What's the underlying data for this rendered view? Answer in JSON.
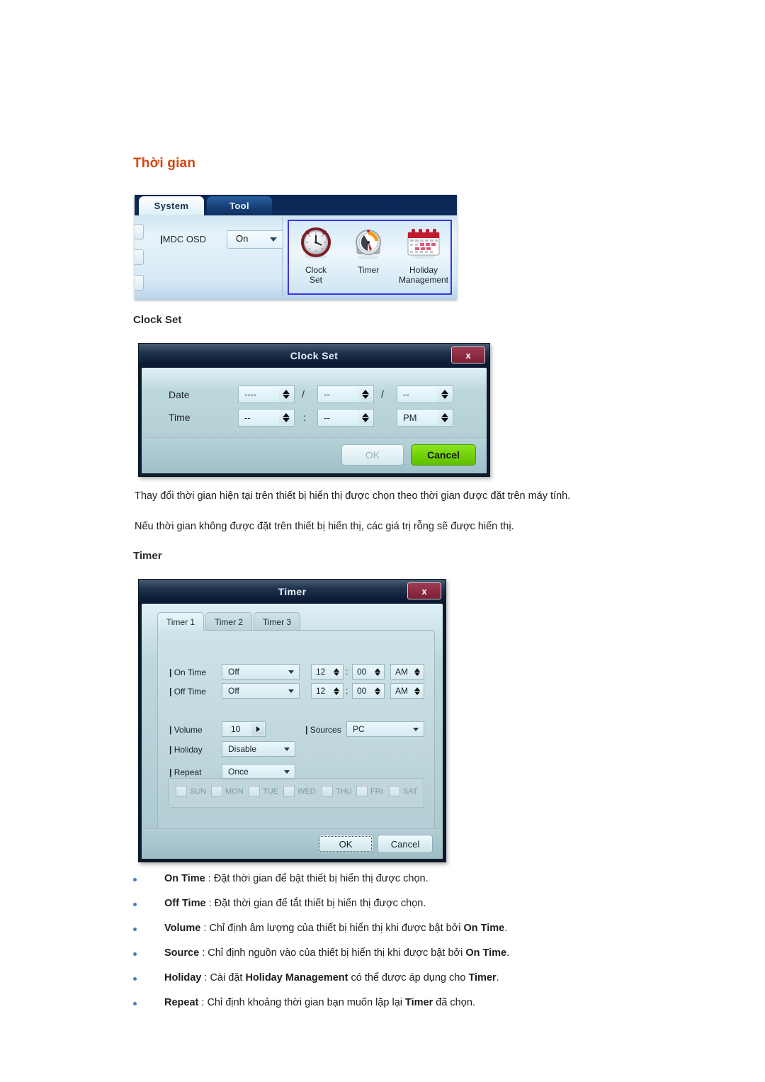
{
  "page": {
    "heading": "Thời gian"
  },
  "ribbon": {
    "tabs": [
      {
        "label": "System",
        "active": true
      },
      {
        "label": "Tool",
        "active": false
      }
    ],
    "setting": {
      "label": "MDC OSD",
      "value": "On"
    },
    "icons": [
      {
        "name": "clock-set",
        "line1": "Clock",
        "line2": "Set"
      },
      {
        "name": "timer",
        "line1": "Timer",
        "line2": ""
      },
      {
        "name": "holiday-management",
        "line1": "Holiday",
        "line2": "Management"
      }
    ],
    "accent_color": "#3a34e8"
  },
  "clock_set": {
    "heading": "Clock Set",
    "dialog_title": "Clock Set",
    "close_label": "x",
    "date_label": "Date",
    "time_label": "Time",
    "date": {
      "year": "----",
      "month": "--",
      "day": "--",
      "separator": "/"
    },
    "time": {
      "hour": "--",
      "minute": "--",
      "meridiem": "PM",
      "separator": ":"
    },
    "buttons": {
      "ok": "OK",
      "cancel": "Cancel",
      "cancel_color": "#78d512"
    }
  },
  "paragraphs": [
    "Thay đổi thời gian hiện tại trên thiết bị hiển thị được chọn theo thời gian được đặt trên máy tính.",
    "Nếu thời gian không được đặt trên thiết bị hiển thị, các giá trị rỗng sẽ được hiển thị."
  ],
  "timer": {
    "heading": "Timer",
    "dialog_title": "Timer",
    "close_label": "x",
    "tabs": [
      {
        "label": "Timer 1",
        "active": true
      },
      {
        "label": "Timer 2",
        "active": false
      },
      {
        "label": "Timer 3",
        "active": false
      }
    ],
    "rows": {
      "on_time": {
        "label": "On Time",
        "mode": "Off",
        "hour": "12",
        "minute": "00",
        "meridiem": "AM",
        "separator": ":"
      },
      "off_time": {
        "label": "Off Time",
        "mode": "Off",
        "hour": "12",
        "minute": "00",
        "meridiem": "AM",
        "separator": ":"
      },
      "volume": {
        "label": "Volume",
        "value": "10"
      },
      "sources": {
        "label": "Sources",
        "value": "PC"
      },
      "holiday": {
        "label": "Holiday",
        "value": "Disable"
      },
      "repeat": {
        "label": "Repeat",
        "value": "Once"
      }
    },
    "days": [
      "SUN",
      "MON",
      "TUE",
      "WED",
      "THU",
      "FRI",
      "SAT"
    ],
    "buttons": {
      "ok": "OK",
      "cancel": "Cancel"
    }
  },
  "descriptions": [
    {
      "term": "On Time",
      "text": " : Đặt thời gian để bật thiết bị hiển thị được chọn."
    },
    {
      "term": "Off Time",
      "text": " : Đặt thời gian để tắt thiết bị hiển thị được chọn."
    },
    {
      "term": "Volume",
      "text": " : Chỉ định âm lượng của thiết bị hiển thị khi được bật bởi ",
      "term2": "On Time",
      "text2": "."
    },
    {
      "term": "Source",
      "text": " : Chỉ định nguồn vào của thiết bị hiển thị khi được bật bởi ",
      "term2": "On Time",
      "text2": "."
    },
    {
      "term": "Holiday",
      "text": " : Cài đặt ",
      "term2": "Holiday Management",
      "text2": " có thể được áp dụng cho ",
      "term3": "Timer",
      "text3": "."
    },
    {
      "term": "Repeat",
      "text": " : Chỉ định khoảng thời gian bạn muốn lặp lại ",
      "term2": "Timer",
      "text2": " đã chọn."
    }
  ]
}
